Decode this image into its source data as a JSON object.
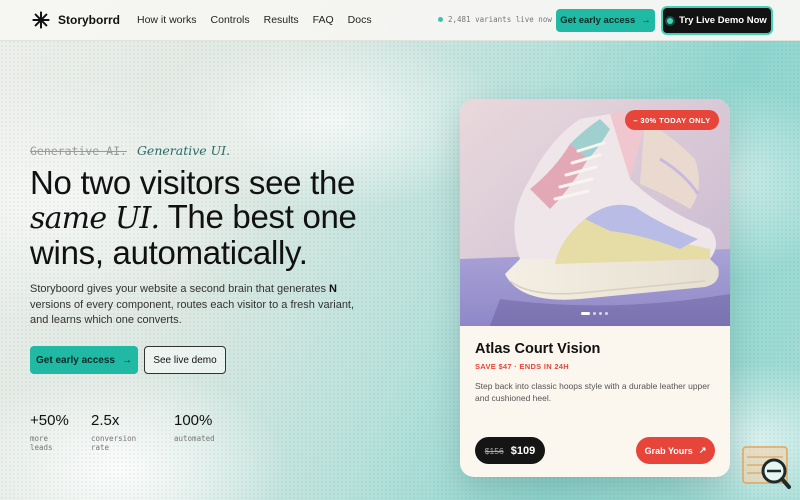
{
  "brand": {
    "name": "Storyborrd"
  },
  "nav": {
    "links": [
      "How it works",
      "Controls",
      "Results",
      "FAQ",
      "Docs"
    ],
    "live_variants": "2,481 variants live now",
    "early_access": "Get early access",
    "live_demo": "Try Live Demo Now"
  },
  "hero": {
    "eyebrow_strike": "Generative AI.",
    "eyebrow_italic": "Generative UI.",
    "headline_1": "No two visitors see the",
    "headline_serif": "same UI.",
    "headline_2": " The best one",
    "headline_3": "wins, automatically.",
    "lede_1": "Storyboord gives your website a second brain that generates ",
    "lede_bold": "N",
    "lede_2": " versions of every component, routes each visitor to a fresh variant, and learns which one converts.",
    "cta_primary": "Get early access",
    "cta_secondary": "See live demo"
  },
  "stats": [
    {
      "value": "+50%",
      "label": "more leads"
    },
    {
      "value": "2.5x",
      "label": "conversion rate"
    },
    {
      "value": "100%",
      "label": "automated"
    }
  ],
  "product": {
    "badge": "– 30% TODAY ONLY",
    "name": "Atlas Court Vision",
    "save": "SAVE $47 · ENDS IN 24H",
    "description": "Step back into classic hoops style with a durable leather upper and cushioned heel.",
    "price_old": "$156",
    "price_new": "$109",
    "cta": "Grab Yours",
    "carousel": {
      "slides": 4,
      "active": 1
    }
  },
  "colors": {
    "accent": "#1fb9a4",
    "sale": "#e8453a",
    "dark": "#121212"
  },
  "icons": [
    "logo-asterisk-icon",
    "arrow-right-icon",
    "arrow-up-right-icon",
    "search-widget-icon"
  ]
}
